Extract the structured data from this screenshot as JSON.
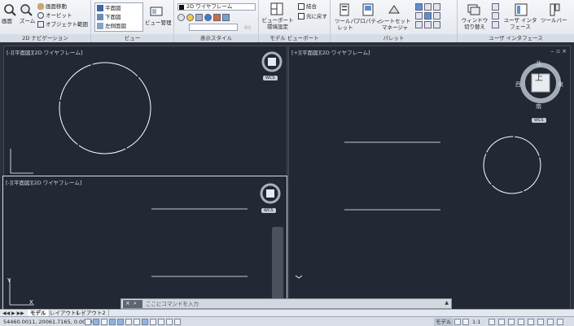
{
  "ribbon": {
    "panels": [
      {
        "title": "2D ナビゲーション",
        "items": [
          "画面移動",
          "オービット",
          "オブジェクト範囲"
        ],
        "big": [
          "画面",
          "ズーム"
        ]
      },
      {
        "title": "ビュー",
        "items": [
          "平面図",
          "下面図",
          "左側面図"
        ],
        "big": [
          "ビュー管理"
        ]
      },
      {
        "title": "表示スタイル",
        "style_value": "2D ワイヤフレーム",
        "num_value": "80"
      },
      {
        "title": "モデル ビューポート",
        "big": [
          "ビューポート環境設定"
        ],
        "items": [
          "結合",
          "元に戻す"
        ]
      },
      {
        "title": "パレット",
        "big": [
          "ツールパレット",
          "プロパティ",
          "シートセットマネージャ"
        ]
      },
      {
        "title": "ユーザ インタフェース",
        "big": [
          "ウィンドウ切り替え",
          "ユーザ インタフェース",
          "ツールバー"
        ]
      }
    ]
  },
  "viewports": {
    "top_left": {
      "label": "[-][平面図][2D ワイヤフレーム]"
    },
    "bottom_left": {
      "label": "[-][平面図][2D ワイヤフレーム]"
    },
    "right": {
      "label": "[+][平面図][2D ワイヤフレーム]"
    }
  },
  "viewcube": {
    "top_face": "上",
    "north": "北",
    "south": "南",
    "east": "東",
    "west": "西",
    "wcs": "WCS"
  },
  "command": {
    "placeholder": "ここにコマンドを入力"
  },
  "tabs": {
    "model": "モデル",
    "layout1": "レイアウト1",
    "layout2": "レイアウト2"
  },
  "status": {
    "coords": "54460.0011, 20061.7165, 0.0000",
    "model_badge": "モデル",
    "scale": "1:1"
  },
  "colors": {
    "canvas": "#222834",
    "ribbon": "#e3e7ee",
    "lines": "#ffffff"
  }
}
